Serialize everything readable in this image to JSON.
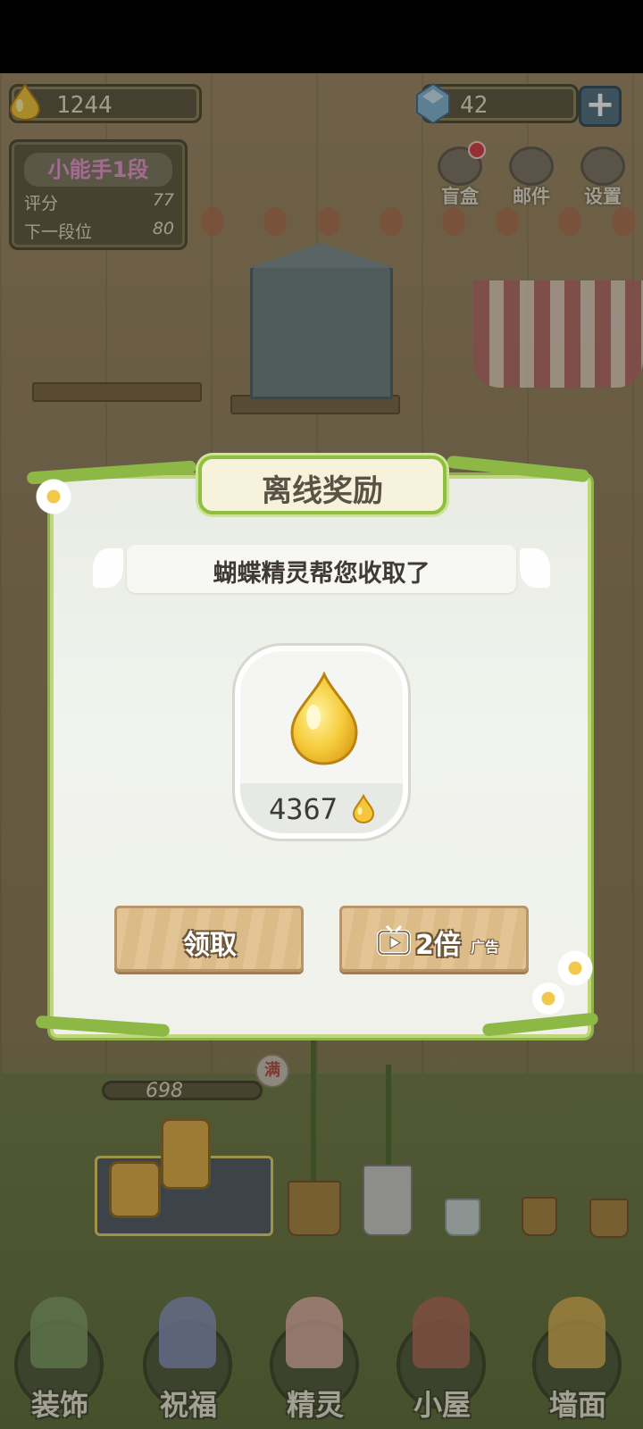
{
  "hud": {
    "drops": "1244",
    "gems": "42",
    "plus_label": "+"
  },
  "rank": {
    "title": "小能手1段",
    "score_label": "评分",
    "score_value": "77",
    "next_label": "下一段位",
    "next_value": "80"
  },
  "top_buttons": [
    {
      "label": "盲盒",
      "icon": "blind-box-icon"
    },
    {
      "label": "邮件",
      "icon": "mail-icon"
    },
    {
      "label": "设置",
      "icon": "gear-icon"
    }
  ],
  "scene": {
    "progress_value": "698",
    "full_badge": "满"
  },
  "dialog": {
    "title": "离线奖励",
    "subtitle": "蝴蝶精灵帮您收取了",
    "reward_amount": "4367",
    "claim_label": "领取",
    "double_label": "2倍",
    "ad_label": "广告"
  },
  "bottom_nav": [
    {
      "label": "装饰",
      "color": "#7fa36a"
    },
    {
      "label": "祝福",
      "color": "#8a96c8"
    },
    {
      "label": "精灵",
      "color": "#e9b7b0"
    },
    {
      "label": "小屋",
      "color": "#b46a5a"
    },
    {
      "label": "墙面",
      "color": "#e0b656"
    }
  ],
  "colors": {
    "dialog_border": "#8fb24a",
    "button_wood": "#e3c495",
    "drop_gold": "#f5c63a"
  }
}
